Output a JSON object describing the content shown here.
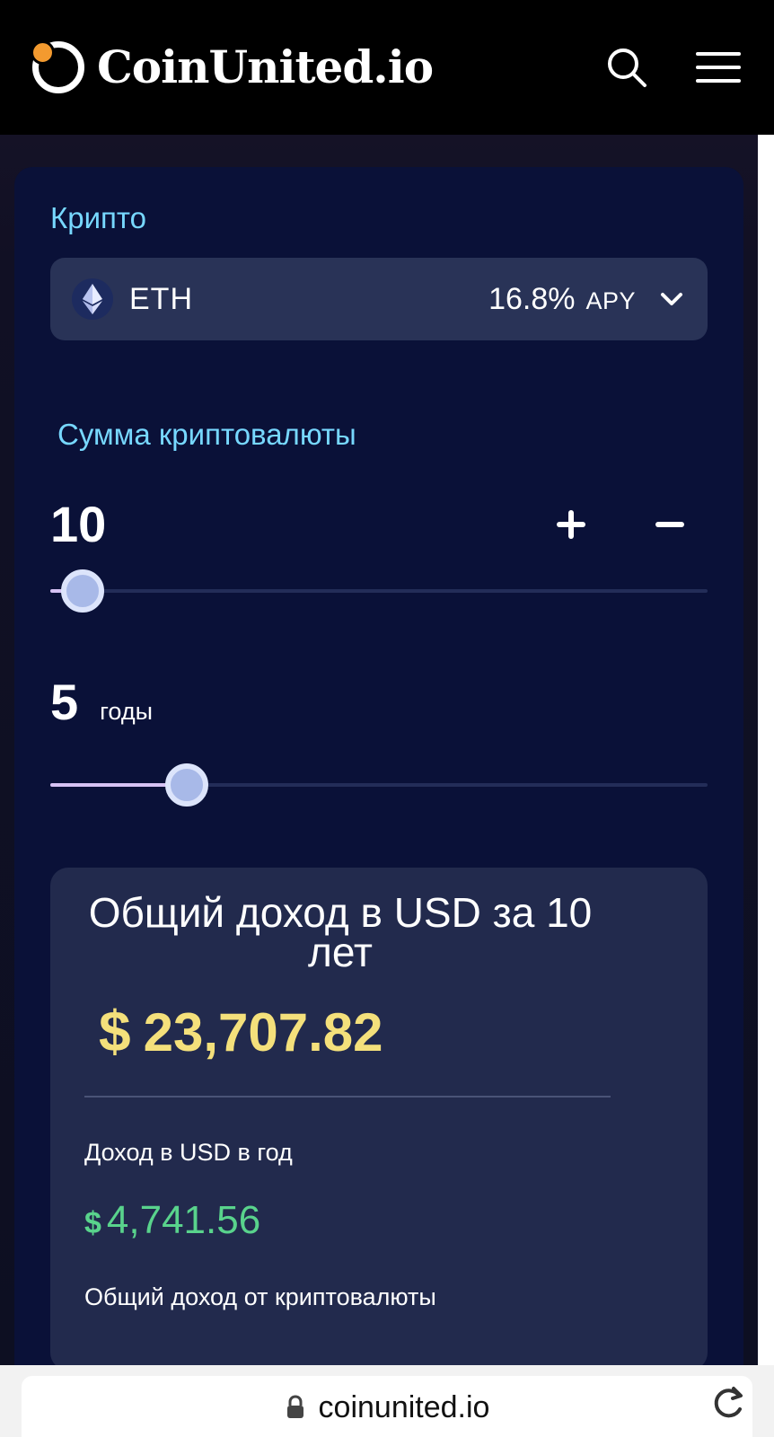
{
  "header": {
    "brand_name": "CoinUnited.io"
  },
  "calculator": {
    "crypto_label": "Крипто",
    "selected_crypto": "ETH",
    "apy_value": "16.8%",
    "apy_label": "APY",
    "amount_label": "Сумма криптовалюты",
    "amount_value": "10",
    "years_value": "5",
    "years_unit": "годы"
  },
  "results": {
    "title": "Общий доход в USD за 10 лет",
    "currency_symbol": "$",
    "total_value": "23,707.82",
    "annual_label": "Доход в USD в год",
    "annual_value": "4,741.56",
    "crypto_income_label": "Общий доход от криптовалюты"
  },
  "browser": {
    "url": "coinunited.io"
  },
  "colors": {
    "accent_cyan": "#77d8ff",
    "total_yellow": "#f4e07b",
    "annual_green": "#59d38c",
    "logo_orange": "#f39a2f"
  }
}
